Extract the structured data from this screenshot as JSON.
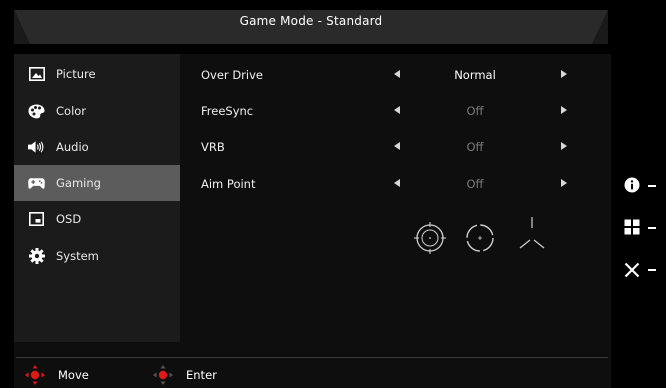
{
  "header": {
    "title": "Game Mode - Standard"
  },
  "sidebar": {
    "items": [
      {
        "label": "Picture",
        "icon": "picture-icon",
        "active": false
      },
      {
        "label": "Color",
        "icon": "palette-icon",
        "active": false
      },
      {
        "label": "Audio",
        "icon": "speaker-icon",
        "active": false
      },
      {
        "label": "Gaming",
        "icon": "gamepad-icon",
        "active": true
      },
      {
        "label": "OSD",
        "icon": "osd-window-icon",
        "active": false
      },
      {
        "label": "System",
        "icon": "gear-icon",
        "active": false
      }
    ]
  },
  "settings": [
    {
      "label": "Over Drive",
      "value": "Normal",
      "enabled": true
    },
    {
      "label": "FreeSync",
      "value": "Off",
      "enabled": false
    },
    {
      "label": "VRB",
      "value": "Off",
      "enabled": false
    },
    {
      "label": "Aim Point",
      "value": "Off",
      "enabled": false
    }
  ],
  "aim_point_options": [
    "crosshair-circle-icon",
    "crosshair-dashed-circle-icon",
    "crosshair-lines-icon"
  ],
  "footer": {
    "move_label": "Move",
    "enter_label": "Enter"
  },
  "side_keys": [
    "info-icon",
    "input-icon",
    "close-icon"
  ],
  "colors": {
    "active_item": "#5c5c5c",
    "sidebar_bg": "#1b1b1b",
    "disabled_text": "#7a7a7a",
    "joystick_red": "#e01818"
  }
}
